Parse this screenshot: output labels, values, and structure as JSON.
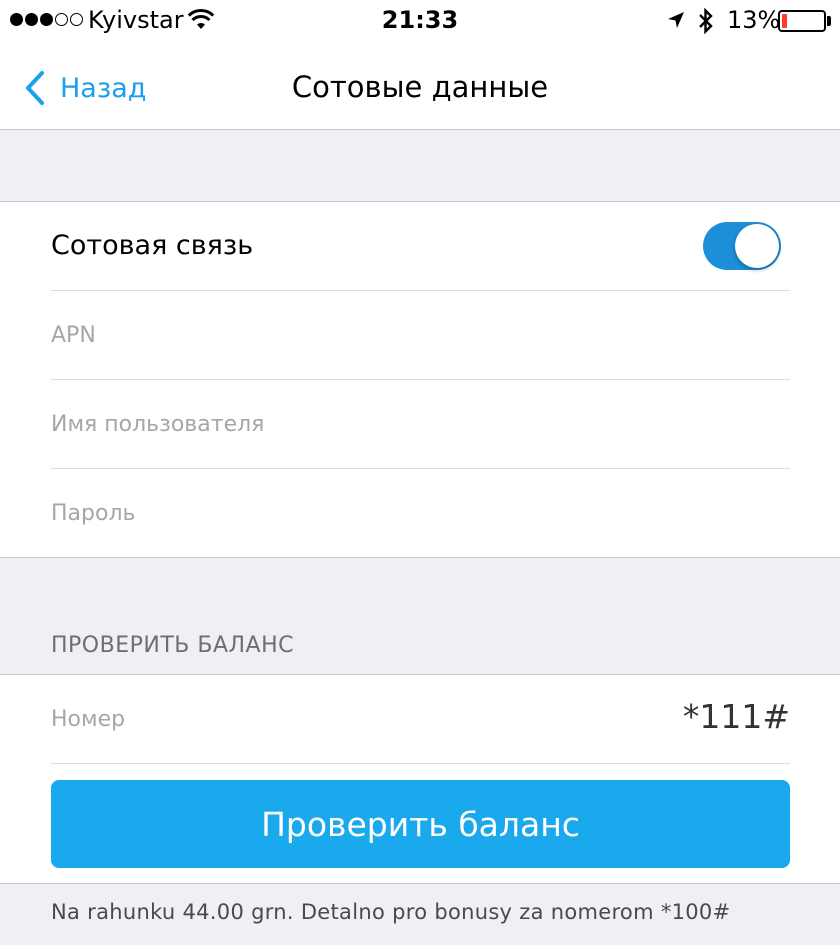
{
  "status_bar": {
    "carrier": "Kyivstar",
    "signal_strength": 3,
    "signal_max": 5,
    "time": "21:33",
    "battery_percent": "13%",
    "battery_level": 0.13,
    "battery_color": "#ff3b30",
    "icons": [
      "wifi-icon",
      "location-arrow-icon",
      "bluetooth-icon",
      "battery-icon"
    ]
  },
  "nav": {
    "back_label": "Назад",
    "title": "Сотовые данные",
    "accent_color": "#1d9ee9"
  },
  "cellular": {
    "toggle_label": "Сотовая связь",
    "toggle_on": true,
    "apn_placeholder": "APN",
    "username_placeholder": "Имя пользователя",
    "password_placeholder": "Пароль"
  },
  "balance": {
    "section_header": "ПРОВЕРИТЬ БАЛАНС",
    "number_label": "Номер",
    "number_value": "*111#",
    "button_label": "Проверить баланс",
    "button_color": "#1aa9ec",
    "result_text": "Na rahunku 44.00 grn. Detalno pro bonusy za nomerom *100#"
  }
}
